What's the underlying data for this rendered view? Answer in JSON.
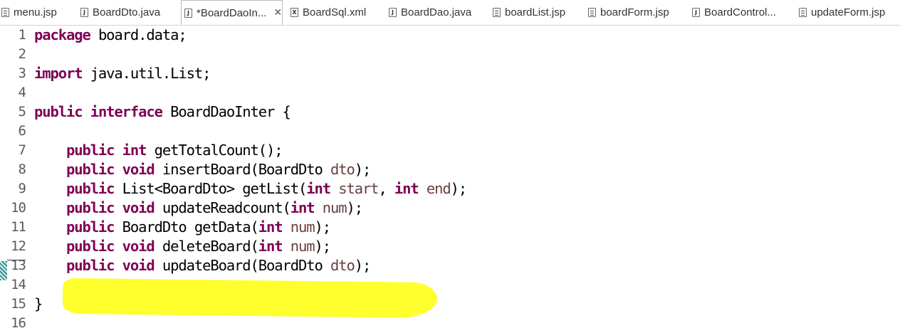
{
  "tabs": [
    {
      "label": "menu.jsp",
      "icon": "jsp-file-icon",
      "active": false
    },
    {
      "label": "BoardDto.java",
      "icon": "java-file-icon",
      "active": false
    },
    {
      "label": "*BoardDaoIn...",
      "icon": "java-file-icon",
      "active": true
    },
    {
      "label": "BoardSql.xml",
      "icon": "xml-file-icon",
      "active": false
    },
    {
      "label": "BoardDao.java",
      "icon": "java-file-icon",
      "active": false
    },
    {
      "label": "boardList.jsp",
      "icon": "jsp-file-icon",
      "active": false
    },
    {
      "label": "boardForm.jsp",
      "icon": "jsp-file-icon",
      "active": false
    },
    {
      "label": "BoardControl...",
      "icon": "java-file-icon",
      "active": false
    },
    {
      "label": "updateForm.jsp",
      "icon": "jsp-file-icon",
      "active": false
    }
  ],
  "close_glyph": "✕",
  "editor": {
    "lines": [
      {
        "n": "1",
        "tokens": [
          {
            "t": "package",
            "k": true
          },
          {
            "t": " board.data;"
          }
        ]
      },
      {
        "n": "2",
        "tokens": []
      },
      {
        "n": "3",
        "tokens": [
          {
            "t": "import",
            "k": true
          },
          {
            "t": " java.util.List;"
          }
        ]
      },
      {
        "n": "4",
        "tokens": []
      },
      {
        "n": "5",
        "tokens": [
          {
            "t": "public",
            "k": true
          },
          {
            "t": " "
          },
          {
            "t": "interface",
            "k": true
          },
          {
            "t": " BoardDaoInter {"
          }
        ]
      },
      {
        "n": "6",
        "tokens": []
      },
      {
        "n": "7",
        "tokens": [
          {
            "t": "    "
          },
          {
            "t": "public",
            "k": true
          },
          {
            "t": " "
          },
          {
            "t": "int",
            "k": true
          },
          {
            "t": " getTotalCount();"
          }
        ]
      },
      {
        "n": "8",
        "tokens": [
          {
            "t": "    "
          },
          {
            "t": "public",
            "k": true
          },
          {
            "t": " "
          },
          {
            "t": "void",
            "k": true
          },
          {
            "t": " insertBoard(BoardDto "
          },
          {
            "t": "dto",
            "p": true
          },
          {
            "t": ");"
          }
        ]
      },
      {
        "n": "9",
        "tokens": [
          {
            "t": "    "
          },
          {
            "t": "public",
            "k": true
          },
          {
            "t": " List<BoardDto> getList("
          },
          {
            "t": "int",
            "k": true
          },
          {
            "t": " "
          },
          {
            "t": "start",
            "p": true
          },
          {
            "t": ", "
          },
          {
            "t": "int",
            "k": true
          },
          {
            "t": " "
          },
          {
            "t": "end",
            "p": true
          },
          {
            "t": ");"
          }
        ]
      },
      {
        "n": "10",
        "tokens": [
          {
            "t": "    "
          },
          {
            "t": "public",
            "k": true
          },
          {
            "t": " "
          },
          {
            "t": "void",
            "k": true
          },
          {
            "t": " updateReadcount("
          },
          {
            "t": "int",
            "k": true
          },
          {
            "t": " "
          },
          {
            "t": "num",
            "p": true
          },
          {
            "t": ");"
          }
        ]
      },
      {
        "n": "11",
        "tokens": [
          {
            "t": "    "
          },
          {
            "t": "public",
            "k": true
          },
          {
            "t": " BoardDto getData("
          },
          {
            "t": "int",
            "k": true
          },
          {
            "t": " "
          },
          {
            "t": "num",
            "p": true
          },
          {
            "t": ");"
          }
        ]
      },
      {
        "n": "12",
        "tokens": [
          {
            "t": "    "
          },
          {
            "t": "public",
            "k": true
          },
          {
            "t": " "
          },
          {
            "t": "void",
            "k": true
          },
          {
            "t": " deleteBoard("
          },
          {
            "t": "int",
            "k": true
          },
          {
            "t": " "
          },
          {
            "t": "num",
            "p": true
          },
          {
            "t": ");"
          }
        ]
      },
      {
        "n": "13",
        "tokens": [
          {
            "t": "    "
          },
          {
            "t": "public",
            "k": true
          },
          {
            "t": " "
          },
          {
            "t": "void",
            "k": true
          },
          {
            "t": " updateBoard(BoardDto "
          },
          {
            "t": "dto",
            "p": true
          },
          {
            "t": ");"
          }
        ]
      },
      {
        "n": "14",
        "tokens": []
      },
      {
        "n": "15",
        "tokens": [
          {
            "t": "}"
          }
        ]
      },
      {
        "n": "16",
        "tokens": []
      }
    ]
  },
  "colors": {
    "keyword": "#7f0055",
    "parameter": "#6a3e3e",
    "highlight": "#ffff2e"
  }
}
